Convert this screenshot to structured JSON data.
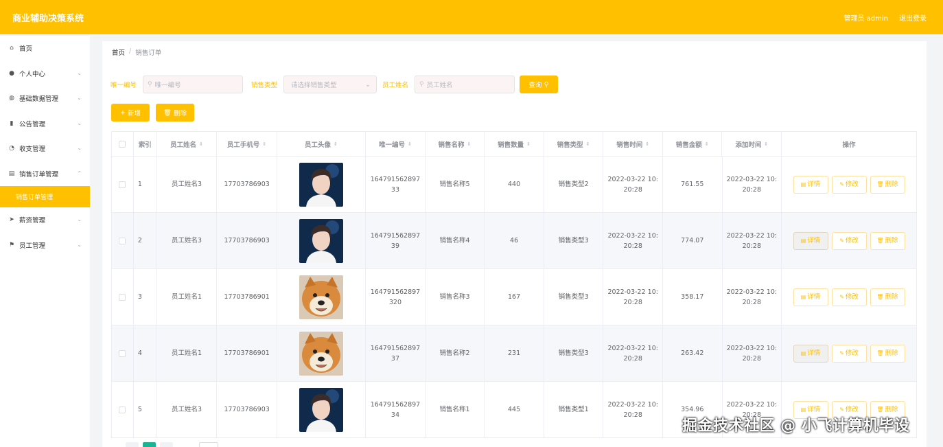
{
  "app": {
    "title": "商业辅助决策系统",
    "user_label": "管理员 admin",
    "logout_label": "退出登录"
  },
  "sidebar": {
    "items": [
      {
        "label": "首页",
        "icon": "home-icon",
        "expandable": false
      },
      {
        "label": "个人中心",
        "icon": "user-icon",
        "expandable": true
      },
      {
        "label": "基础数据管理",
        "icon": "globe-icon",
        "expandable": true
      },
      {
        "label": "公告管理",
        "icon": "bar-chart-icon",
        "expandable": true
      },
      {
        "label": "收支管理",
        "icon": "clock-icon",
        "expandable": true
      },
      {
        "label": "销售订单管理",
        "icon": "document-icon",
        "expandable": true,
        "expanded": true
      },
      {
        "label": "销售订单管理",
        "sub": true,
        "active": true
      },
      {
        "label": "薪资管理",
        "icon": "send-icon",
        "expandable": true
      },
      {
        "label": "员工管理",
        "icon": "flag-icon",
        "expandable": true
      }
    ]
  },
  "breadcrumb": {
    "home": "首页",
    "sep": "/",
    "current": "销售订单"
  },
  "search": {
    "uid_label": "唯一编号",
    "uid_placeholder": "唯一编号",
    "type_label": "销售类型",
    "type_placeholder": "请选择销售类型",
    "name_label": "员工姓名",
    "name_placeholder": "员工姓名",
    "query_label": "查询"
  },
  "actions": {
    "add_label": "新增",
    "delete_label": "删除"
  },
  "table": {
    "headers": [
      "索引",
      "员工姓名",
      "员工手机号",
      "员工头像",
      "唯一编号",
      "销售名称",
      "销售数量",
      "销售类型",
      "销售时间",
      "销售金额",
      "添加时间",
      "操作"
    ],
    "op_labels": {
      "detail": "详情",
      "edit": "修改",
      "delete": "删除"
    },
    "rows": [
      {
        "index": "1",
        "name": "员工姓名3",
        "phone": "17703786903",
        "avatar": "boy",
        "uid": "16479156289733",
        "sale_name": "销售名称5",
        "qty": "440",
        "type": "销售类型2",
        "sale_time": "2022-03-22 10:20:28",
        "amount": "761.55",
        "add_time": "2022-03-22 10:20:28"
      },
      {
        "index": "2",
        "name": "员工姓名3",
        "phone": "17703786903",
        "avatar": "boy",
        "uid": "16479156289739",
        "sale_name": "销售名称4",
        "qty": "46",
        "type": "销售类型3",
        "sale_time": "2022-03-22 10:20:28",
        "amount": "774.07",
        "add_time": "2022-03-22 10:20:28"
      },
      {
        "index": "3",
        "name": "员工姓名1",
        "phone": "17703786901",
        "avatar": "dog",
        "uid": "164791562897320",
        "sale_name": "销售名称3",
        "qty": "167",
        "type": "销售类型3",
        "sale_time": "2022-03-22 10:20:28",
        "amount": "358.17",
        "add_time": "2022-03-22 10:20:28"
      },
      {
        "index": "4",
        "name": "员工姓名1",
        "phone": "17703786901",
        "avatar": "dog",
        "uid": "16479156289737",
        "sale_name": "销售名称2",
        "qty": "231",
        "type": "销售类型3",
        "sale_time": "2022-03-22 10:20:28",
        "amount": "263.42",
        "add_time": "2022-03-22 10:20:28"
      },
      {
        "index": "5",
        "name": "员工姓名3",
        "phone": "17703786903",
        "avatar": "boy",
        "uid": "16479156289734",
        "sale_name": "销售名称1",
        "qty": "445",
        "type": "销售类型1",
        "sale_time": "2022-03-22 10:20:28",
        "amount": "354.96",
        "add_time": "2022-03-22 10:20:28"
      }
    ]
  },
  "watermark": "掘金技术社区 @ 小飞计算机毕设",
  "colors": {
    "accent": "#ffc000",
    "pager_active": "#1ab394"
  }
}
